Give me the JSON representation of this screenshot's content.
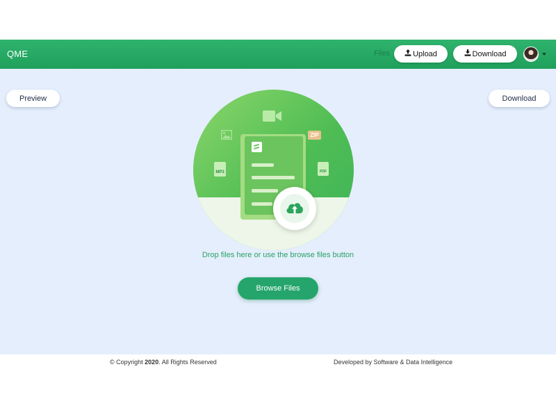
{
  "navbar": {
    "brand": "QME",
    "files_label": "Files",
    "upload_label": "Upload",
    "download_label": "Download",
    "avatar_icon": "user-avatar",
    "caret_icon": "chevron-down-icon",
    "background": "#22a461"
  },
  "main": {
    "preview_label": "Preview",
    "download_label": "Download",
    "background": "#e5eefc",
    "illustration": {
      "icons": [
        "video-camera-icon",
        "image-icon",
        "zip-file-icon",
        "mp3-file-icon",
        "pdf-file-icon",
        "document-icon",
        "cloud-upload-icon"
      ],
      "zip_text": "ZIP",
      "mp3_text": "MP3",
      "pdf_text": "PDF"
    },
    "drop_text": "Drop files here or use the browse files button",
    "browse_label": "Browse Files",
    "accent": "#25a56b"
  },
  "footer": {
    "copyright_prefix": "© Copyright",
    "copyright_year": "2020",
    "copyright_suffix": ". All Rights Reserved",
    "developed_by": "Developed by Software & Data Intelligence"
  }
}
